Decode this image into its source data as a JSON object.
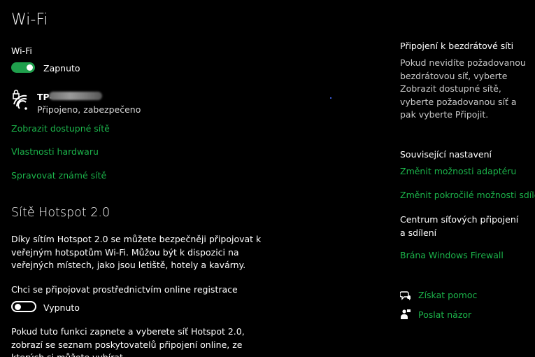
{
  "page": {
    "title": "Wi-Fi"
  },
  "wifi": {
    "section_label": "Wi-Fi",
    "toggle_state": "Zapnuto",
    "network": {
      "ssid_prefix": "TP-",
      "status": "Připojeno, zabezpečeno"
    },
    "links": {
      "show_available": "Zobrazit dostupné sítě",
      "hardware_properties": "Vlastnosti hardwaru",
      "manage_known": "Spravovat známé sítě"
    }
  },
  "hotspot": {
    "heading": "Sítě Hotspot 2.0",
    "description": "Díky sítím Hotspot 2.0 se můžete bezpečněji připojovat k veřejným hotspotům Wi-Fi. Můžou být k dispozici na veřejných místech, jako jsou letiště, hotely a kavárny.",
    "online_signup_label": "Chci se připojovat prostřednictvím online registrace",
    "online_signup_state": "Vypnuto",
    "footer": "Pokud tuto funkci zapnete a vyberete síť Hotspot 2.0, zobrazí se seznam poskytovatelů připojení online, ze kterých si můžete vybírat."
  },
  "sidebar": {
    "wireless_title": "Připojení k bezdrátové síti",
    "wireless_text": "Pokud nevidíte požadovanou bezdrátovou síť, vyberte Zobrazit dostupné sítě, vyberte požadovanou síť a pak vyberte Připojit.",
    "related_title": "Související nastavení",
    "related_links": [
      "Změnit možnosti adaptéru",
      "Změnit pokročilé možnosti sdílení",
      "Centrum síťových připojení a sdílení",
      "Brána Windows Firewall"
    ],
    "get_help": "Získat pomoc",
    "send_feedback": "Poslat názor"
  },
  "colors": {
    "accent": "#1bb34a",
    "toggle_on": "#1f9f4c",
    "background": "#000000"
  }
}
